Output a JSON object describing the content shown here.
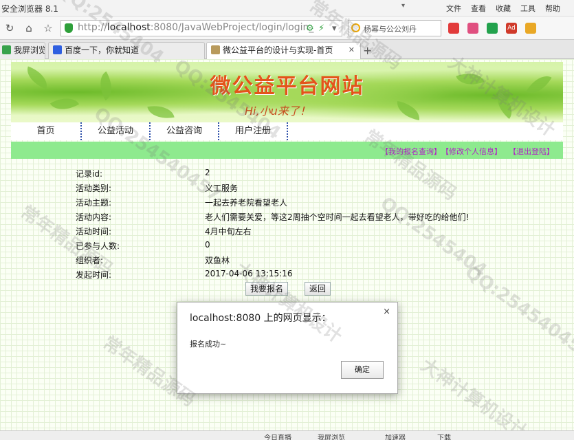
{
  "window": {
    "title": "安全浏览器 8.1",
    "menu": [
      "文件",
      "查看",
      "收藏",
      "工具",
      "帮助"
    ]
  },
  "addressbar": {
    "url_prefix": "http://",
    "url_host": "localhost",
    "url_rest": ":8080/JavaWebProject/login/login_",
    "search_text": "杨幂与公公刘丹"
  },
  "tabs": [
    {
      "label": "我屏浏览"
    },
    {
      "label": "百度一下，你就知道"
    },
    {
      "label": "微公益平台的设计与实现-首页",
      "active": true
    }
  ],
  "site": {
    "title": "微公益平台网站",
    "greeting": "Hi,小u来了！"
  },
  "nav": [
    "首页",
    "公益活动",
    "公益咨询",
    "用户注册"
  ],
  "userlinks": [
    "【我的报名查询】",
    "【修改个人信息】",
    "【退出登陆】"
  ],
  "details": [
    {
      "label": "记录id:",
      "value": "2"
    },
    {
      "label": "活动类别:",
      "value": "义工服务"
    },
    {
      "label": "活动主题:",
      "value": "一起去养老院看望老人"
    },
    {
      "label": "活动内容:",
      "value": "老人们需要关爱，等这2周抽个空时间一起去看望老人，带好吃的给他们!"
    },
    {
      "label": "活动时间:",
      "value": "4月中旬左右"
    },
    {
      "label": "已参与人数:",
      "value": "0"
    },
    {
      "label": "组织者:",
      "value": "双鱼林"
    },
    {
      "label": "发起时间:",
      "value": "2017-04-06 13:15:16"
    }
  ],
  "buttons": {
    "signup": "我要报名",
    "back": "返回"
  },
  "dialog": {
    "title": "localhost:8080 上的网页显示：",
    "message": "报名成功~",
    "ok": "确定",
    "close": "×"
  },
  "statusbar": [
    "今日直播",
    "我屏浏览",
    "加速器",
    "下载"
  ],
  "watermarks": [
    "QQ:2545404",
    "常年精品源码",
    "大神计算机设计",
    "QQ:254540457",
    "常年精品源码",
    "QQ:2545404",
    "大神计算机设计",
    "常年精品源码",
    "QQ:254540457",
    "QQ:2545404",
    "常年精品源码",
    "大神计算机设计"
  ]
}
